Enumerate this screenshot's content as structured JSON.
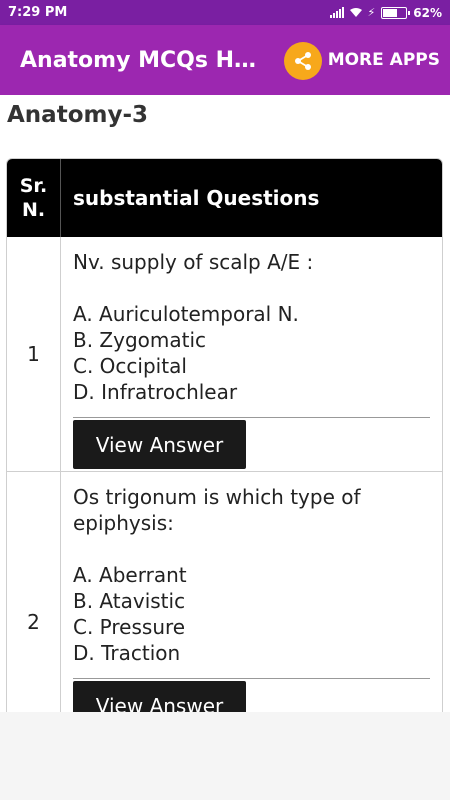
{
  "status_bar": {
    "time": "7:29 PM",
    "battery": "62%",
    "battery_level": 0.62
  },
  "app_bar": {
    "title": "Anatomy MCQs Handbook",
    "more_apps": "MORE APPS",
    "share_icon": "share-icon"
  },
  "page": {
    "heading": "Anatomy-3"
  },
  "table": {
    "header": {
      "col1": "Sr. N.",
      "col2": "substantial Questions"
    },
    "rows": [
      {
        "number": "1",
        "question": "Nv. supply of scalp A/E :",
        "options": [
          "A. Auriculotemporal N.",
          "B. Zygomatic",
          "C. Occipital",
          "D. Infratrochlear"
        ],
        "button": "View Answer"
      },
      {
        "number": "2",
        "question": "Os trigonum is which type of epiphysis:",
        "options": [
          "A. Aberrant",
          "B. Atavistic",
          "C. Pressure",
          "D. Traction"
        ],
        "button": "View Answer"
      }
    ]
  },
  "colors": {
    "status_bar": "#7a1fa2",
    "app_bar": "#9c27b0",
    "share_button": "#f7a81b",
    "header_bg": "#000000"
  }
}
